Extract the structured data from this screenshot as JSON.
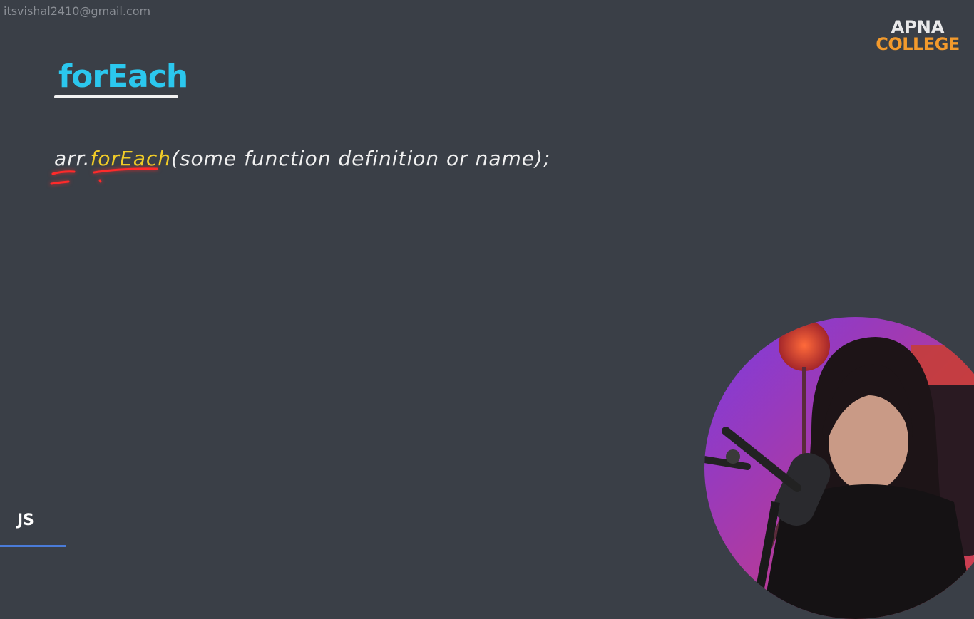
{
  "watermark": {
    "email": "itsvishal2410@gmail.com"
  },
  "logo": {
    "line1": "APNA",
    "line2": "COLLEGE"
  },
  "slide": {
    "title": "forEach",
    "code": {
      "object": "arr",
      "dot": ".",
      "method": "forEach",
      "args": "(some function definition or name);"
    }
  },
  "footer": {
    "badge": "JS"
  },
  "colors": {
    "background": "#3a3f47",
    "title": "#2bc7ee",
    "method_highlight": "#f1cc27",
    "annotation": "#ff2a2a",
    "logo_accent": "#f39a2c"
  }
}
